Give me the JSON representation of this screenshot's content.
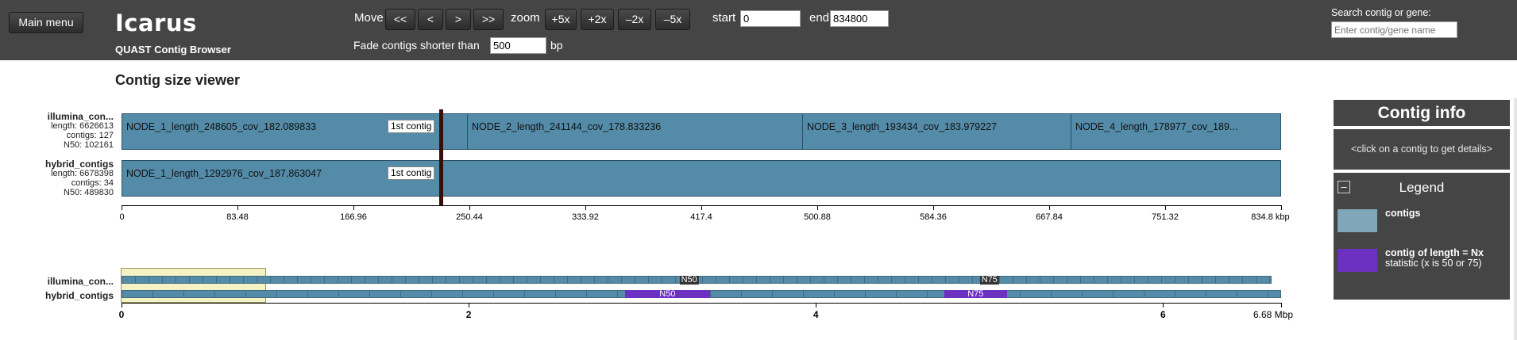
{
  "header": {
    "main_menu": "Main menu",
    "title": "Icarus",
    "subtitle": "QUAST Contig Browser",
    "move_label": "Move",
    "move_buttons": [
      "<<",
      "<",
      ">",
      ">>"
    ],
    "zoom_label": "zoom",
    "zoom_buttons": [
      "+5x",
      "+2x",
      "–2x",
      "–5x"
    ],
    "start_label": "start",
    "start_value": "0",
    "end_label": "end",
    "end_value": "834800",
    "fade_label": "Fade contigs shorter than",
    "fade_value": "500",
    "fade_unit": "bp",
    "search_label": "Search contig or gene:",
    "search_placeholder": "Enter contig/gene name"
  },
  "page_title": "Contig size viewer",
  "assemblies": [
    {
      "name": "illumina_con...",
      "length": "length: 6626613",
      "contigs": "contigs: 127",
      "n50": "N50: 102161",
      "contig_labels": [
        "NODE_1_length_248605_cov_182.089833",
        "NODE_2_length_241144_cov_178.833236",
        "NODE_3_length_193434_cov_183.979227",
        "NODE_4_length_178977_cov_189..."
      ],
      "contig_lengths_bp": [
        248605,
        241144,
        193434,
        178977
      ]
    },
    {
      "name": "hybrid_contigs",
      "length": "length: 6678398",
      "contigs": "contigs: 34",
      "n50": "N50: 489830",
      "contig_labels": [
        "NODE_1_length_1292976_cov_187.863047"
      ],
      "contig_lengths_bp": [
        1292976
      ]
    }
  ],
  "first_contig_label": "1st contig",
  "main_axis": {
    "range_kbp": [
      0,
      834.8
    ],
    "ticks": [
      "0",
      "83.48",
      "166.96",
      "250.44",
      "333.92",
      "417.4",
      "500.88",
      "584.36",
      "667.84",
      "751.32",
      "834.8 kbp"
    ]
  },
  "overview": {
    "names": [
      "illumina_con...",
      "hybrid_contigs"
    ],
    "ticks": [
      "0",
      "2",
      "4",
      "6",
      "6.68 Mbp"
    ],
    "tick_values_mbp": [
      0,
      2,
      4,
      6,
      6.68
    ],
    "window_mbp": [
      0,
      0.8348
    ],
    "illumina_total_mbp": 6.626613,
    "hybrid_total_mbp": 6.678398,
    "illumina_n50_label": "N50",
    "illumina_n75_label": "N75",
    "illumina_n50_at_mbp": 3.27,
    "illumina_n75_at_mbp": 5.0,
    "hybrid_n50_label": "N50",
    "hybrid_n75_label": "N75",
    "hybrid_n50_range_mbp": [
      2.9,
      3.39
    ],
    "hybrid_n75_range_mbp": [
      4.74,
      5.1
    ]
  },
  "contig_info": {
    "title": "Contig info",
    "hint": "<click on a contig to get details>"
  },
  "legend": {
    "toggle": "–",
    "title": "Legend",
    "items": [
      {
        "label": "contigs",
        "desc": "",
        "color": "#7fa6b9"
      },
      {
        "label": "contig of length = Nx",
        "desc": "statistic (x is 50 or 75)",
        "color": "#6c31c0"
      }
    ]
  },
  "colors": {
    "header_bg": "#454545",
    "contig": "#548ba8",
    "nx_highlight": "#6c31c0",
    "overview_window": "#f5f2c3"
  }
}
